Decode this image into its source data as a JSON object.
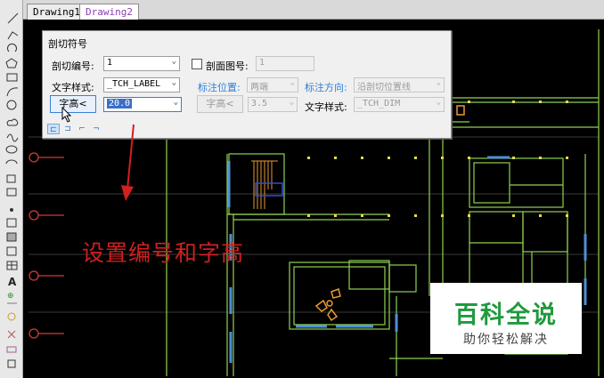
{
  "tabs": [
    {
      "label": "Drawing1"
    },
    {
      "label": "Drawing2"
    }
  ],
  "toolbar": {
    "icons": [
      "line-icon",
      "polyline-icon",
      "undo-arc-icon",
      "polygon-icon",
      "rectangle-icon",
      "arc-icon",
      "circle-icon",
      "cloud-icon",
      "spline-icon",
      "ellipse-icon",
      "ellipse-arc-icon",
      "block-insert-icon",
      "block-make-icon",
      "point-icon",
      "hatch-icon",
      "gradient-icon",
      "region-icon",
      "table-icon",
      "text-icon",
      "add-selected-icon",
      "lamp-icon",
      "scissors-icon",
      "eraser-icon",
      "copy-icon"
    ]
  },
  "dialog": {
    "title": "剖切符号",
    "section_number_label": "剖切编号:",
    "section_number_value": "1",
    "section_drawing_checkbox_label": "剖面图号:",
    "section_drawing_value": "1",
    "text_style_label": "文字样式:",
    "text_style_value": "_TCH_LABEL",
    "label_position_label": "标注位置:",
    "label_position_value": "两端",
    "label_direction_label": "标注方向:",
    "label_direction_value": "沿剖切位置线",
    "text_height_button": "字高<",
    "text_height_value": "20.0",
    "text_height2_button": "字高<",
    "text_height2_value": "3.5",
    "text_style2_label": "文字样式:",
    "text_style2_value": "_TCH_DIM",
    "mode_buttons": [
      "正交剖切",
      "非正交剖切",
      "折线剖切",
      "阶梯剖切"
    ]
  },
  "annotation": {
    "text": "设置编号和字高",
    "color": "#d21f1f"
  },
  "watermark": {
    "main": "百科全说",
    "sub": "助你轻松解决",
    "color": "#1f9a3d"
  },
  "colors": {
    "wall": "#8fd14f",
    "window": "#4f8fd6",
    "column": "#e8d84a",
    "axis_circle": "#d23a3a",
    "stair": "#e89a30"
  }
}
